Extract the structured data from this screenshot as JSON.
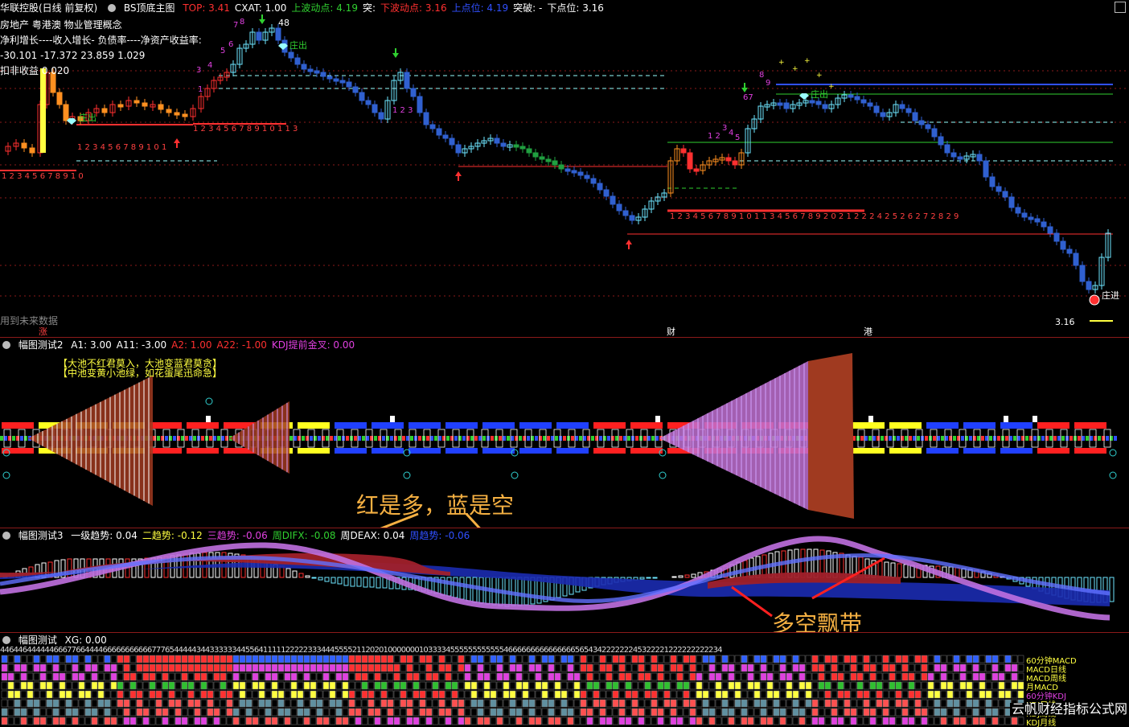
{
  "main": {
    "title": "华联控股(日线 前复权)",
    "indicator": "BS顶底主图",
    "readouts": [
      {
        "label": "TOP: 3.41",
        "color": "#ff3030"
      },
      {
        "label": "CXAT: 1.00",
        "color": "#ffffff"
      },
      {
        "label": "上波动点: 4.19",
        "color": "#30d030"
      },
      {
        "label": "突:",
        "color": "#ffffff"
      },
      {
        "label": "下波动点: 3.16",
        "color": "#ff3030"
      },
      {
        "label": "上点位: 4.19",
        "color": "#3050ff"
      },
      {
        "label": "突破: -",
        "color": "#ffffff"
      },
      {
        "label": "下点位: 3.16",
        "color": "#ffffff"
      }
    ],
    "info_rows": [
      "房地产          粤港澳 物业管理概念",
      "净利增长----收入增长-     负债率----净资产收益率:",
      "-30.101        -17.372       23.859        1.029",
      "扣非收益      0.020"
    ],
    "footer_note": "用到未来数据",
    "bottom_markers": [
      "涨",
      "财",
      "港"
    ],
    "labels": {
      "zhuang_chu_1": "庄出",
      "zhuang_chu_2": "庄出",
      "zhuang_chu_3": "庄出",
      "zhuang_jin": "庄进",
      "low_price": "3.16",
      "count_1": "1 2 3 4 5 6 7 8 9 1 0",
      "count_2": "1 2 3 4 5 6 7 8 9 1 0 1",
      "count_3": "1 2 3 4 5 6 7 8 9 1 0 1 1 3",
      "count_4": "1 2 3 4 5 6 7 8 9 1 0 1 1 3 4 5 6 7 8 9 2 0 2 1 2 2 2 4 2 5 2 6 2 7 2 8 2 9",
      "top_num": "48"
    }
  },
  "ind2": {
    "title": "幅图测试2",
    "readouts": [
      {
        "label": "A1: 3.00",
        "color": "#ffffff"
      },
      {
        "label": "A11: -3.00",
        "color": "#ffffff"
      },
      {
        "label": "A2: 1.00",
        "color": "#ff3030"
      },
      {
        "label": "A22: -1.00",
        "color": "#ff3030"
      },
      {
        "label": "KDJ提前金叉: 0.00",
        "color": "#e040e0"
      }
    ],
    "legend_line1": "【大池不红君莫入，大池变蓝君莫贪】",
    "legend_line2": "【中池变黄小池绿，如花蛋尾迅命急】",
    "annotation": "红是多，蓝是空"
  },
  "ind3": {
    "title": "幅图测试3",
    "readouts": [
      {
        "label": "一级趋势: 0.04",
        "color": "#ffffff"
      },
      {
        "label": "二趋势: -0.12",
        "color": "#ffff40"
      },
      {
        "label": "三趋势: -0.06",
        "color": "#e040e0"
      },
      {
        "label": "周DIFX: -0.08",
        "color": "#30d030"
      },
      {
        "label": "周DEAX: 0.04",
        "color": "#ffffff"
      },
      {
        "label": "周趋势: -0.06",
        "color": "#3050ff"
      }
    ],
    "annotation": "多空飘带"
  },
  "ind4": {
    "title": "幅图测试",
    "readouts": [
      {
        "label": "XG: 0.00",
        "color": "#ffffff"
      }
    ],
    "digits": "4 4 6 4 4 6 4 4 4 4 4 4 6 6 6 7 7 6 6 4 4 4 4 6 6 6 6 6 6 6 6 6 6 6 7 7 7 6 5 4 4 4 4 4 3 4 4 3 3 3 3 3 3 4 4 5 5 6 4 1 1 1 1 1 2 2 2 2 2 3 3 3 4 4 4 5 5 5 5 2 1 1 2 0 2 0 1 0 0 0 0 0 0 0 1 0 3 3 3 3 4 5 5 5 5 5 5 5 5 5 5 5 5 4 6 6 6 6 6 6 6 6 6 6 6 6 6 6 6 5 6 5 4 3 4 2 2 2 2 2 2 2 4 5 3 2 2 2 2 1 2 2 2 2 2 2 2 2 2 2 3 4",
    "row_labels": [
      "60分钟MACD",
      "MACD日线",
      "MACD周线",
      "月MACD",
      "60分钟KDJ",
      "KDJ日线",
      "KDJ周线",
      "KDJ月线"
    ]
  },
  "watermark": "云帆财经指标公式网"
}
